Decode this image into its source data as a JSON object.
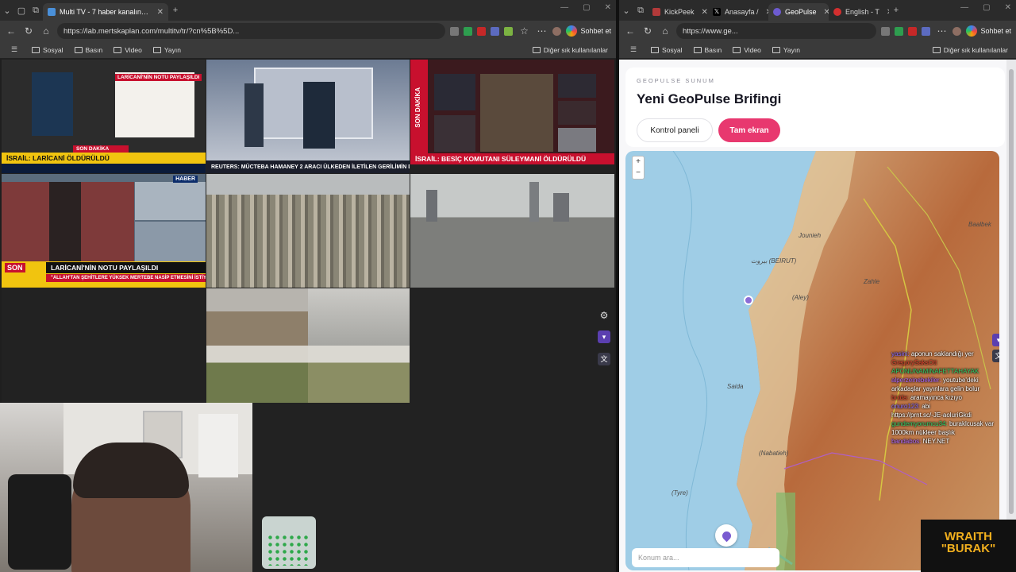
{
  "left_window": {
    "tabs": [
      {
        "title": "Multi TV - 7 haber kanalını aynı anda",
        "active": true
      }
    ],
    "url": "https://lab.mertskaplan.com/multitv/tr/?cn%5B%5D...",
    "favorites": [
      "Sosyal",
      "Basın",
      "Video",
      "Yayın"
    ],
    "favorites_right": "Diğer sık kullanılanlar",
    "copilot": "Sohbet et",
    "feeds": {
      "news1_ticker_top": "SON DAKİKA",
      "news1_ticker": "İSRAİL: LARİCANİ ÖLDÜRÜLDÜ",
      "news1_caption": "LARİCANİ'NİN NOTU PAYLAŞILDI",
      "news2_ticker": "REUTERS: MÜCTEBA HAMANEY 2 ARACI ÜLKEDEN İLETİLEN GERİLİMİN DÜŞÜRÜLMESİNE DAİR TEKLİFLERİ REDDETTİ",
      "news3_label": "SON DAKİKA",
      "news3_ticker": "İSRAİL: BESİÇ KOMUTANI SÜLEYMANİ ÖLDÜRÜLDÜ",
      "news4_badge": "HABER",
      "news4_tag": "SON",
      "news4_ticker": "LARİCANİ'NİN NOTU PAYLAŞILDI",
      "news4_sub": "\"ALLAH'TAN ŞEHİTLERE YÜKSEK MERTEBE NASİP ETMESİNİ İSTİYORUM\""
    }
  },
  "right_window": {
    "tabs": [
      {
        "title": "KickPeek",
        "active": false
      },
      {
        "title": "Anasayfa /",
        "active": false
      },
      {
        "title": "GeoPulse",
        "active": true
      },
      {
        "title": "English - T",
        "active": false
      }
    ],
    "url": "https://www.ge...",
    "favorites": [
      "Sosyal",
      "Basın",
      "Video",
      "Yayın"
    ],
    "favorites_right": "Diğer sık kullanılanlar",
    "copilot": "Sohbet et",
    "page": {
      "eyebrow": "GEOPULSE SUNUM",
      "title": "Yeni GeoPulse Brifingi",
      "btn_panel": "Kontrol paneli",
      "btn_fullscreen": "Tam ekran",
      "search_placeholder": "Konum ara...",
      "map_labels": [
        "بيروت (BEIRUT)",
        "Jounieh",
        "Zahle",
        "(Aley)",
        "Saida",
        "(Nabatieh)",
        "(Tyre)",
        "Baalbek"
      ]
    }
  },
  "chat": [
    {
      "user": "yasini:",
      "text": "aponun saklandığı yer"
    },
    {
      "user": "GregorySaksOtt",
      "text": ""
    },
    {
      "user": "APONUNAMINAFETTAHAYAK",
      "text": ""
    },
    {
      "user": "alperzeinebekiler:",
      "text": "youtube'deki arkadaşlar yayınlara gelin bolur"
    },
    {
      "user": "bolda:",
      "text": "aramayınca kızıyo"
    },
    {
      "user": "onuro123:",
      "text": "abi"
    },
    {
      "user": "",
      "text": "https://prnt.sc/-JE-aoluriGkdi"
    },
    {
      "user": "gundemyorumcu34:",
      "text": "buraklcusak var 1000km nükleer başlık"
    },
    {
      "user": "bandabos:",
      "text": "NEY.NET"
    }
  ],
  "branding": {
    "line1": "WRAITH",
    "line2": "\"BURAK\""
  },
  "colors": {
    "accent_pink": "#e8386f",
    "accent_purple": "#5b3fb0",
    "brand_gold": "#f2b01e"
  }
}
